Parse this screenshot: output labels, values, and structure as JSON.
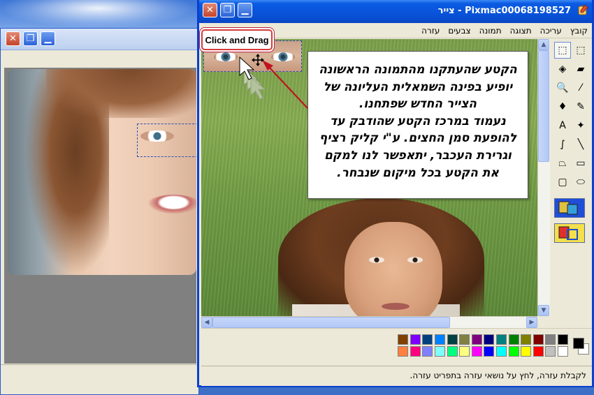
{
  "main_window": {
    "title": "Pixmac00068198527 - צייר",
    "menu": [
      "קובץ",
      "עריכה",
      "תצוגה",
      "תמונה",
      "צבעים",
      "עזרה"
    ],
    "status": "לקבלת עזרה, לחץ על נושאי עזרה בתפריט עזרה."
  },
  "callout": {
    "drag_label": "Click and Drag",
    "lines": [
      "הקטע שהעתקנו מהתמונה הראשונה",
      "יופיע בפינה השמאלית העליונה של",
      "הצייר החדש שפתחנו.",
      "נעמוד במרכז הקטע שהודבק עד",
      "להופעת סמן החצים. ע\"י קליק רציף",
      "וגרירת העכבר, יתאפשר לנו למקם",
      "את הקטע בכל מיקום שנבחר."
    ]
  },
  "window_buttons": {
    "close": "✕",
    "maximize": "❐",
    "minimize": "▁"
  },
  "tools": [
    [
      "free-select-icon",
      "⬚"
    ],
    [
      "rect-select-icon",
      "⬚"
    ],
    [
      "eraser-icon",
      "▰"
    ],
    [
      "fill-icon",
      "◈"
    ],
    [
      "color-picker-icon",
      "⁄"
    ],
    [
      "magnifier-icon",
      "🔍"
    ],
    [
      "pencil-icon",
      "✎"
    ],
    [
      "brush-icon",
      "♦"
    ],
    [
      "airbrush-icon",
      "✦"
    ],
    [
      "text-icon",
      "A"
    ],
    [
      "line-icon",
      "╲"
    ],
    [
      "curve-icon",
      "∫"
    ],
    [
      "rectangle-icon",
      "▭"
    ],
    [
      "polygon-icon",
      "⏢"
    ],
    [
      "ellipse-icon",
      "⬭"
    ],
    [
      "rounded-rect-icon",
      "▢"
    ]
  ],
  "palette": {
    "top": [
      "#000000",
      "#808080",
      "#800000",
      "#808000",
      "#008000",
      "#008080",
      "#000080",
      "#800080",
      "#808040",
      "#004040",
      "#0080ff",
      "#004080",
      "#8000ff",
      "#804000"
    ],
    "bottom": [
      "#ffffff",
      "#c0c0c0",
      "#ff0000",
      "#ffff00",
      "#00ff00",
      "#00ffff",
      "#0000ff",
      "#ff00ff",
      "#ffff80",
      "#00ff80",
      "#80ffff",
      "#8080ff",
      "#ff0080",
      "#ff8040"
    ],
    "foreground": "#000000",
    "background": "#ffffff"
  }
}
